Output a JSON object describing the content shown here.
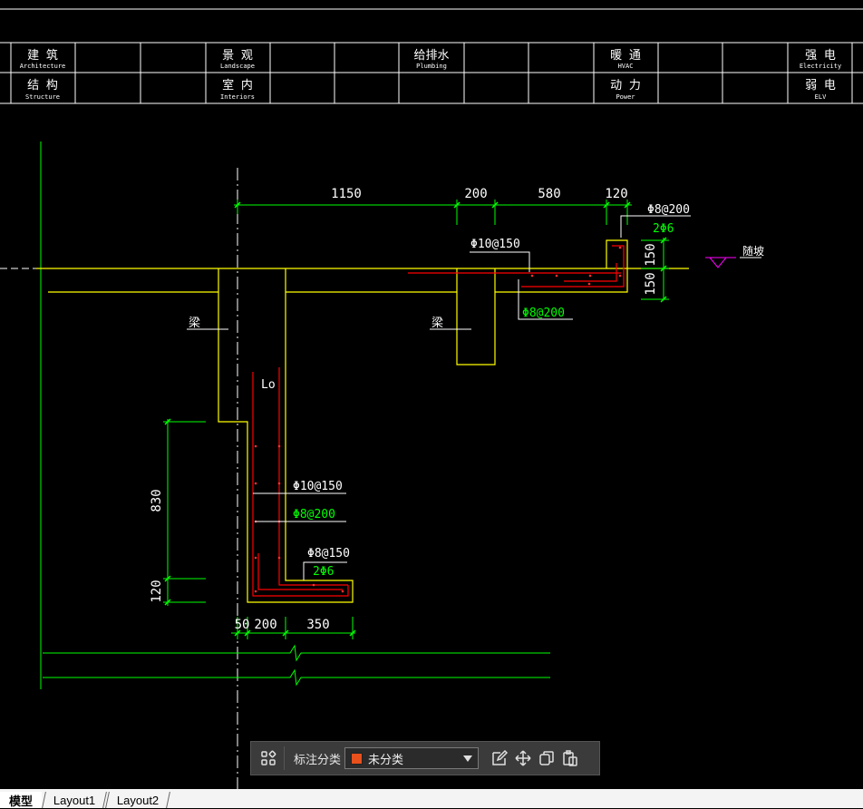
{
  "header_table": {
    "row1": [
      {
        "cn": "建 筑",
        "en": "Architecture"
      },
      {
        "cn": "景 观",
        "en": "Landscape"
      },
      {
        "cn": "给排水",
        "en": "Plumbing"
      },
      {
        "cn": "暖 通",
        "en": "HVAC"
      },
      {
        "cn": "强 电",
        "en": "Electricity"
      }
    ],
    "row2": [
      {
        "cn": "结 构",
        "en": "Structure"
      },
      {
        "cn": "室 内",
        "en": "Interiors"
      },
      {
        "cn": "",
        "en": ""
      },
      {
        "cn": "动 力",
        "en": "Power"
      },
      {
        "cn": "弱 电",
        "en": "ELV"
      }
    ]
  },
  "drawing": {
    "dims_top": {
      "d1150": "1150",
      "d200": "200",
      "d580": "580",
      "d120": "120"
    },
    "dims_vertical_right": {
      "upper": "150",
      "lower": "150"
    },
    "dims_left": {
      "d830": "830",
      "d120": "120"
    },
    "dims_bottom": {
      "d50": "50",
      "d200": "200",
      "d350": "350"
    },
    "rebar_labels": {
      "r1": "Φ8@200",
      "r2": "2Φ6",
      "r3": "Φ10@150",
      "r4": "Φ8@200",
      "r5": "Φ10@150",
      "r6": "Φ8@200",
      "r7": "Φ8@150",
      "r8": "2Φ6"
    },
    "beam_label_left": "梁",
    "beam_label_right": "梁",
    "wall_label": "Lo",
    "elevation_label": "随坡"
  },
  "toolbar": {
    "label": "标注分类",
    "selected": "未分类",
    "swatch_color": "#e8501c",
    "icons": [
      "grid-icon",
      "edit-icon",
      "move-icon",
      "copy-icon",
      "paste-icon"
    ]
  },
  "tabs": [
    "模型",
    "Layout1",
    "Layout2"
  ],
  "colors": {
    "white": "#ffffff",
    "yellow": "#ffff00",
    "green": "#00ff00",
    "red": "#ff0000",
    "magenta": "#ff00ff"
  }
}
